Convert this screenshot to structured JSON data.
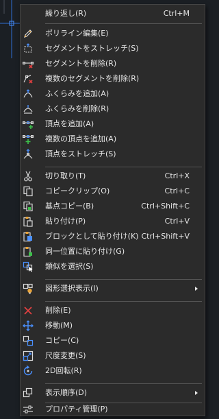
{
  "menu": {
    "repeat": {
      "label": "繰り返し(R)",
      "shortcut": "Ctrl+M"
    },
    "polyline_edit": {
      "label": "ポリライン編集(E)"
    },
    "stretch_segment": {
      "label": "セグメントをストレッチ(S)"
    },
    "delete_segment": {
      "label": "セグメントを削除(R)"
    },
    "delete_segments": {
      "label": "複数のセグメントを削除(R)"
    },
    "add_bulge": {
      "label": "ふくらみを追加(A)"
    },
    "delete_bulge": {
      "label": "ふくらみを削除(R)"
    },
    "add_vertex": {
      "label": "頂点を追加(A)"
    },
    "add_vertices": {
      "label": "複数の頂点を追加(A)"
    },
    "stretch_vertex": {
      "label": "頂点をストレッチ(S)"
    },
    "cut": {
      "label": "切り取り(T)",
      "shortcut": "Ctrl+X"
    },
    "copy_clip": {
      "label": "コピークリップ(O)",
      "shortcut": "Ctrl+C"
    },
    "copy_base": {
      "label": "基点コピー(B)",
      "shortcut": "Ctrl+Shift+C"
    },
    "paste": {
      "label": "貼り付け(P)",
      "shortcut": "Ctrl+V"
    },
    "paste_block": {
      "label": "ブロックとして貼り付け(K)",
      "shortcut": "Ctrl+Shift+V"
    },
    "paste_orig": {
      "label": "同一位置に貼り付け(G)"
    },
    "select_similar": {
      "label": "類似を選択(S)"
    },
    "isolate": {
      "label": "図形選択表示(I)"
    },
    "erase": {
      "label": "削除(E)"
    },
    "move": {
      "label": "移動(M)"
    },
    "copy": {
      "label": "コピー(C)"
    },
    "scale": {
      "label": "尺度変更(S)"
    },
    "rotate": {
      "label": "2D回転(R)"
    },
    "draw_order": {
      "label": "表示順序(D)"
    },
    "properties": {
      "label": "プロパティ管理(P)"
    }
  }
}
